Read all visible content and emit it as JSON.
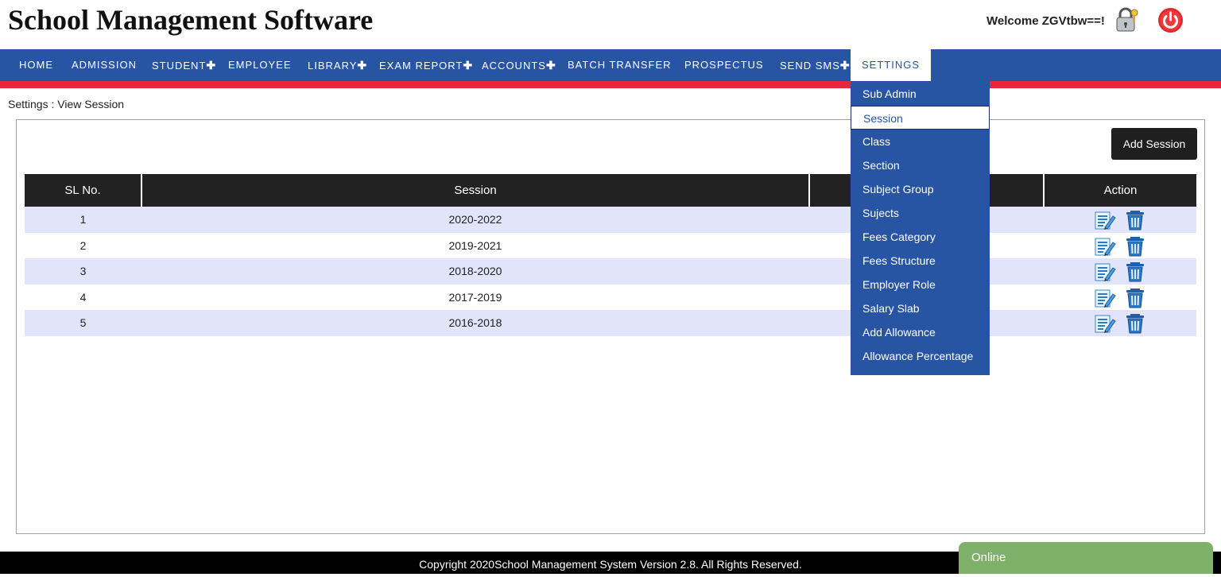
{
  "header": {
    "title": "School Management Software",
    "welcome": "Welcome ZGVtbw==!",
    "lock_label": "Change Password"
  },
  "nav": {
    "items": [
      {
        "label": "HOME",
        "plus": ""
      },
      {
        "label": "ADMISSION",
        "plus": ""
      },
      {
        "label": "STUDENT",
        "plus": "✚"
      },
      {
        "label": "EMPLOYEE",
        "plus": ""
      },
      {
        "label": "LIBRARY",
        "plus": "✚"
      },
      {
        "label": "EXAM REPORT",
        "plus": "✚"
      },
      {
        "label": "ACCOUNTS",
        "plus": "✚"
      },
      {
        "label": "BATCH TRANSFER",
        "plus": ""
      },
      {
        "label": "PROSPECTUS",
        "plus": ""
      },
      {
        "label": "SEND SMS",
        "plus": "✚"
      },
      {
        "label": "SETTINGS",
        "plus": ""
      }
    ]
  },
  "settings_menu": {
    "items": [
      "Sub Admin",
      "Session",
      "Class",
      "Section",
      "Subject Group",
      "Sujects",
      "Fees Category",
      "Fees Structure",
      "Employer Role",
      "Salary Slab",
      "Add Allowance",
      "Allowance Percentage"
    ],
    "selected": "Session"
  },
  "breadcrumb": "Settings : View Session",
  "add_button": "Add Session",
  "table": {
    "headers": [
      "SL No.",
      "Session",
      "",
      "Action"
    ],
    "rows": [
      {
        "sl": "1",
        "session": "2020-2022"
      },
      {
        "sl": "2",
        "session": "2019-2021"
      },
      {
        "sl": "3",
        "session": "2018-2020"
      },
      {
        "sl": "4",
        "session": "2017-2019"
      },
      {
        "sl": "5",
        "session": "2016-2018"
      }
    ]
  },
  "footer": "Copyright 2020School Management System Version 2.8. All Rights Reserved.",
  "chat": {
    "status": "Online"
  },
  "colors": {
    "nav_bg": "#2755a3",
    "nav_strip": "#e4293b",
    "row_alt": "#e1e4fb",
    "chat_bg": "#7fb069",
    "power": "#e02a2a"
  },
  "icons": {
    "lock": "lock-icon",
    "power": "power-icon",
    "edit": "edit-icon",
    "delete": "trash-icon"
  }
}
